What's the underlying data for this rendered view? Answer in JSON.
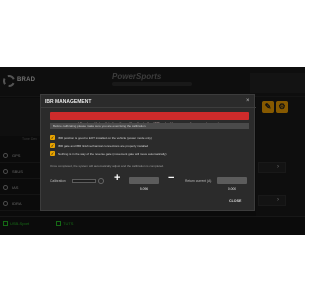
{
  "app": {
    "brand_left": "BRAD",
    "brand_center": "PowerSports",
    "side_header_text": "Tune Dev"
  },
  "signals": [
    {
      "label": "GPS"
    },
    {
      "label": "SBUS"
    },
    {
      "label": "IAS"
    },
    {
      "label": "IDRA"
    }
  ],
  "toolbar": {
    "wrench_icon": "wrench-icon",
    "gear_icon": "gear-icon"
  },
  "status_bar": {
    "left_text": "USB-Sport",
    "right_text": "TUTS"
  },
  "modal": {
    "title": "IBR MANAGEMENT",
    "close_glyph": "×",
    "warning": "Warning: Using this function will activate the IBR gate. Keep away from moving parts",
    "note": "Before calibrating please make sure you are exercising the calibration.",
    "checks": [
      "IBR position is good to EOT installed on the vehicle (power mode only)",
      "IBR gate and IBR link/mechanical connections are properly installed",
      "Nothing is in the way of the reverse gate (movement gate will move automatically)"
    ],
    "info": "Once completed, the system will automatically adjust and the calibration is completed.",
    "calibration_label": "Calibration",
    "plus_glyph": "+",
    "field_a_value": "5.096",
    "minus_glyph": "−",
    "return_label": "Return current (A)",
    "field_b_value": "0.000",
    "close_label": "CLOSE"
  },
  "colors": {
    "warning": "#ce2b2b",
    "accent_orange": "#f5a300",
    "status_green": "#27c227"
  }
}
